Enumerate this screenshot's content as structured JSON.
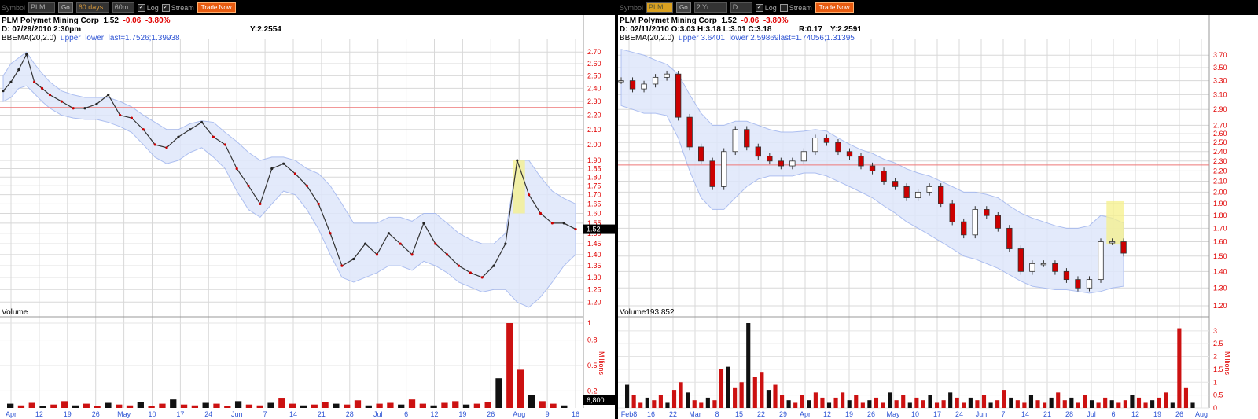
{
  "toolbar": {
    "left": {
      "symbol_label": "Symbol",
      "symbol": "PLM",
      "go": "Go",
      "period": "60 days",
      "interval": "60m",
      "log": "Log",
      "stream": "Stream",
      "trade": "Trade Now"
    },
    "right": {
      "symbol_label": "Symbol",
      "symbol": "PLM",
      "go": "Go",
      "period": "2 Yr",
      "interval": "D",
      "log": "Log",
      "stream": "Stream",
      "trade": "Trade Now"
    }
  },
  "left": {
    "company": "PLM Polymet Mining Corp",
    "price": "1.52",
    "change": "-0.06",
    "change_pct": "-3.80%",
    "info": "D: 07/29/2010    2:30pm",
    "y": "Y:2.2554",
    "bb_label": "BBEMA(20,2.0)",
    "bb_upper": "upper",
    "bb_lower": "lower",
    "bb_last": "last=1.7526;1.39938",
    "volume_label": "Volume",
    "volume_box": "6,800",
    "price_box": "1.52"
  },
  "right": {
    "company": "PLM Polymet Mining Corp",
    "price": "1.52",
    "change": "-0.06",
    "change_pct": "-3.80%",
    "info": "D: 02/11/2010 O:3.03 H:3.18 L:3.01 C:3.18",
    "r": "R:0.17",
    "y": "Y:2.2591",
    "bb_label": "BBEMA(20,2.0)",
    "bb_upper": "upper 3.6401",
    "bb_lower": "lower 2.59869",
    "bb_last": "last=1.74056;1.31395",
    "volume_label": "Volume",
    "volume_value": "193,852"
  },
  "chart_data": [
    {
      "type": "line",
      "log_scale": true,
      "grid": true,
      "x_ticks": [
        "Apr",
        "12",
        "19",
        "26",
        "May",
        "10",
        "17",
        "24",
        "Jun",
        "7",
        "14",
        "21",
        "28",
        "Jul",
        "6",
        "12",
        "19",
        "26",
        "Aug",
        "9",
        "16"
      ],
      "y_ticks": [
        "2.70",
        "2.60",
        "2.50",
        "2.40",
        "2.30",
        "2.20",
        "2.10",
        "2.00",
        "1.90",
        "1.85",
        "1.80",
        "1.75",
        "1.70",
        "1.65",
        "1.60",
        "1.55",
        "1.50",
        "1.45",
        "1.40",
        "1.35",
        "1.30",
        "1.25",
        "1.20"
      ],
      "y_range": [
        1.15,
        2.75
      ],
      "x_range": [
        0,
        149
      ],
      "reference_line_y": 2.2554,
      "series": [
        {
          "x": [
            0,
            2,
            4,
            6,
            8,
            10,
            12,
            15,
            18,
            21,
            24,
            27,
            30,
            33,
            36,
            39,
            42,
            45,
            48,
            51,
            54,
            57,
            60,
            63,
            66,
            69,
            72,
            75,
            78,
            81,
            84,
            87,
            90,
            93,
            96,
            99,
            102,
            105,
            108,
            111,
            114,
            117,
            120,
            123,
            126,
            129,
            132,
            135,
            138,
            141,
            144,
            147
          ],
          "y": [
            2.38,
            2.45,
            2.55,
            2.68,
            2.45,
            2.4,
            2.35,
            2.3,
            2.25,
            2.25,
            2.28,
            2.35,
            2.2,
            2.18,
            2.1,
            2.0,
            1.98,
            2.05,
            2.1,
            2.15,
            2.05,
            2.0,
            1.85,
            1.75,
            1.65,
            1.85,
            1.88,
            1.82,
            1.75,
            1.65,
            1.5,
            1.35,
            1.38,
            1.45,
            1.4,
            1.5,
            1.45,
            1.4,
            1.55,
            1.45,
            1.4,
            1.35,
            1.32,
            1.3,
            1.35,
            1.45,
            1.9,
            1.7,
            1.6,
            1.55,
            1.55,
            1.52
          ]
        }
      ],
      "bollinger_upper": [
        2.5,
        2.6,
        2.65,
        2.7,
        2.6,
        2.52,
        2.45,
        2.38,
        2.35,
        2.33,
        2.33,
        2.33,
        2.3,
        2.26,
        2.2,
        2.15,
        2.1,
        2.1,
        2.14,
        2.16,
        2.15,
        2.08,
        2.02,
        1.95,
        1.9,
        1.92,
        1.92,
        1.9,
        1.85,
        1.82,
        1.75,
        1.65,
        1.55,
        1.55,
        1.55,
        1.58,
        1.58,
        1.56,
        1.6,
        1.6,
        1.55,
        1.5,
        1.47,
        1.45,
        1.45,
        1.5,
        1.9,
        1.9,
        1.8,
        1.72,
        1.68,
        1.65
      ],
      "bollinger_lower": [
        2.3,
        2.33,
        2.4,
        2.42,
        2.36,
        2.3,
        2.25,
        2.2,
        2.18,
        2.17,
        2.17,
        2.15,
        2.12,
        2.08,
        2.0,
        1.92,
        1.88,
        1.9,
        1.95,
        1.98,
        1.92,
        1.85,
        1.72,
        1.62,
        1.58,
        1.65,
        1.72,
        1.7,
        1.62,
        1.52,
        1.4,
        1.3,
        1.28,
        1.3,
        1.32,
        1.35,
        1.35,
        1.33,
        1.37,
        1.35,
        1.32,
        1.28,
        1.26,
        1.24,
        1.25,
        1.25,
        1.2,
        1.18,
        1.22,
        1.28,
        1.35,
        1.4
      ],
      "highlight": {
        "x_from": 131,
        "x_to": 134,
        "y_from": 1.6,
        "y_to": 1.9
      },
      "volume": {
        "y_ticks": [
          "1",
          "0.8",
          "0.5",
          "0.2"
        ],
        "unit": "Millions",
        "values": [
          0.05,
          0.03,
          0.06,
          0.02,
          0.04,
          0.08,
          0.03,
          0.05,
          0.02,
          0.06,
          0.04,
          0.03,
          0.07,
          0.02,
          0.05,
          0.1,
          0.04,
          0.03,
          0.06,
          0.05,
          0.02,
          0.08,
          0.04,
          0.03,
          0.06,
          0.12,
          0.05,
          0.03,
          0.04,
          0.07,
          0.05,
          0.04,
          0.09,
          0.03,
          0.05,
          0.06,
          0.04,
          0.1,
          0.05,
          0.03,
          0.06,
          0.08,
          0.04,
          0.05,
          0.07,
          0.35,
          1.0,
          0.45,
          0.15,
          0.08,
          0.05,
          0.03
        ]
      }
    },
    {
      "type": "candlestick",
      "log_scale": true,
      "grid": true,
      "x_ticks": [
        "Feb8",
        "16",
        "22",
        "Mar",
        "8",
        "15",
        "22",
        "29",
        "Apr",
        "12",
        "19",
        "26",
        "May",
        "10",
        "17",
        "24",
        "Jun",
        "7",
        "14",
        "21",
        "28",
        "Jul",
        "6",
        "12",
        "19",
        "26",
        "Aug"
      ],
      "y_ticks": [
        "3.70",
        "3.50",
        "3.30",
        "3.10",
        "2.90",
        "2.70",
        "2.60",
        "2.50",
        "2.40",
        "2.30",
        "2.20",
        "2.10",
        "2.00",
        "1.90",
        "1.80",
        "1.70",
        "1.60",
        "1.50",
        "1.40",
        "1.30",
        "1.20"
      ],
      "y_range": [
        1.15,
        3.85
      ],
      "x_range": [
        0,
        103
      ],
      "reference_line_y": 2.2591,
      "series": [
        {
          "name": "Close",
          "x": [
            0,
            2,
            4,
            6,
            8,
            10,
            12,
            14,
            16,
            18,
            20,
            22,
            24,
            26,
            28,
            30,
            32,
            34,
            36,
            38,
            40,
            42,
            44,
            46,
            48,
            50,
            52,
            54,
            56,
            58,
            60,
            62,
            64,
            66,
            68,
            70,
            72,
            74,
            76,
            78,
            80,
            82,
            84,
            86,
            88
          ],
          "y": [
            3.3,
            3.18,
            3.25,
            3.35,
            3.4,
            2.8,
            2.45,
            2.3,
            2.05,
            2.4,
            2.65,
            2.45,
            2.35,
            2.3,
            2.25,
            2.3,
            2.4,
            2.55,
            2.5,
            2.4,
            2.35,
            2.25,
            2.2,
            2.1,
            2.05,
            1.95,
            2.0,
            2.05,
            1.9,
            1.75,
            1.65,
            1.85,
            1.8,
            1.7,
            1.55,
            1.4,
            1.45,
            1.45,
            1.4,
            1.35,
            1.3,
            1.35,
            1.6,
            1.6,
            1.52
          ]
        }
      ],
      "bollinger_upper": [
        3.8,
        3.75,
        3.7,
        3.62,
        3.55,
        3.4,
        3.1,
        2.85,
        2.7,
        2.7,
        2.75,
        2.75,
        2.7,
        2.65,
        2.62,
        2.62,
        2.63,
        2.65,
        2.63,
        2.55,
        2.48,
        2.42,
        2.38,
        2.32,
        2.28,
        2.22,
        2.18,
        2.15,
        2.1,
        2.05,
        2.0,
        2.0,
        1.98,
        1.95,
        1.88,
        1.82,
        1.78,
        1.75,
        1.72,
        1.7,
        1.7,
        1.72,
        1.8,
        1.78,
        1.74
      ],
      "bollinger_lower": [
        2.95,
        2.9,
        2.85,
        2.85,
        2.82,
        2.55,
        2.2,
        1.95,
        1.85,
        1.85,
        1.95,
        2.05,
        2.12,
        2.15,
        2.15,
        2.15,
        2.18,
        2.18,
        2.15,
        2.1,
        2.05,
        2.0,
        1.95,
        1.88,
        1.82,
        1.75,
        1.7,
        1.65,
        1.6,
        1.55,
        1.5,
        1.48,
        1.45,
        1.42,
        1.38,
        1.34,
        1.31,
        1.3,
        1.29,
        1.29,
        1.28,
        1.27,
        1.28,
        1.3,
        1.31
      ],
      "highlight": {
        "x_from": 85,
        "x_to": 88,
        "y_from": 1.58,
        "y_to": 1.92
      },
      "volume": {
        "y_ticks": [
          "3",
          "2.5",
          "2",
          "1.5",
          "1",
          "0.5",
          "0"
        ],
        "unit": "Millions",
        "values": [
          0.9,
          0.5,
          0.2,
          0.4,
          0.3,
          0.5,
          0.2,
          0.7,
          1.0,
          0.6,
          0.3,
          0.2,
          0.4,
          0.3,
          1.5,
          1.6,
          0.8,
          1.0,
          3.3,
          1.2,
          1.4,
          0.7,
          0.9,
          0.5,
          0.3,
          0.2,
          0.5,
          0.3,
          0.6,
          0.4,
          0.2,
          0.4,
          0.6,
          0.3,
          0.5,
          0.2,
          0.3,
          0.4,
          0.2,
          0.6,
          0.3,
          0.5,
          0.2,
          0.4,
          0.3,
          0.5,
          0.2,
          0.3,
          0.6,
          0.4,
          0.2,
          0.4,
          0.3,
          0.5,
          0.2,
          0.3,
          0.7,
          0.4,
          0.3,
          0.2,
          0.5,
          0.3,
          0.2,
          0.4,
          0.6,
          0.3,
          0.4,
          0.2,
          0.5,
          0.3,
          0.2,
          0.4,
          0.3,
          0.2,
          0.3,
          0.5,
          0.4,
          0.2,
          0.3,
          0.4,
          0.6,
          0.2,
          3.1,
          0.8,
          0.2
        ]
      }
    }
  ]
}
